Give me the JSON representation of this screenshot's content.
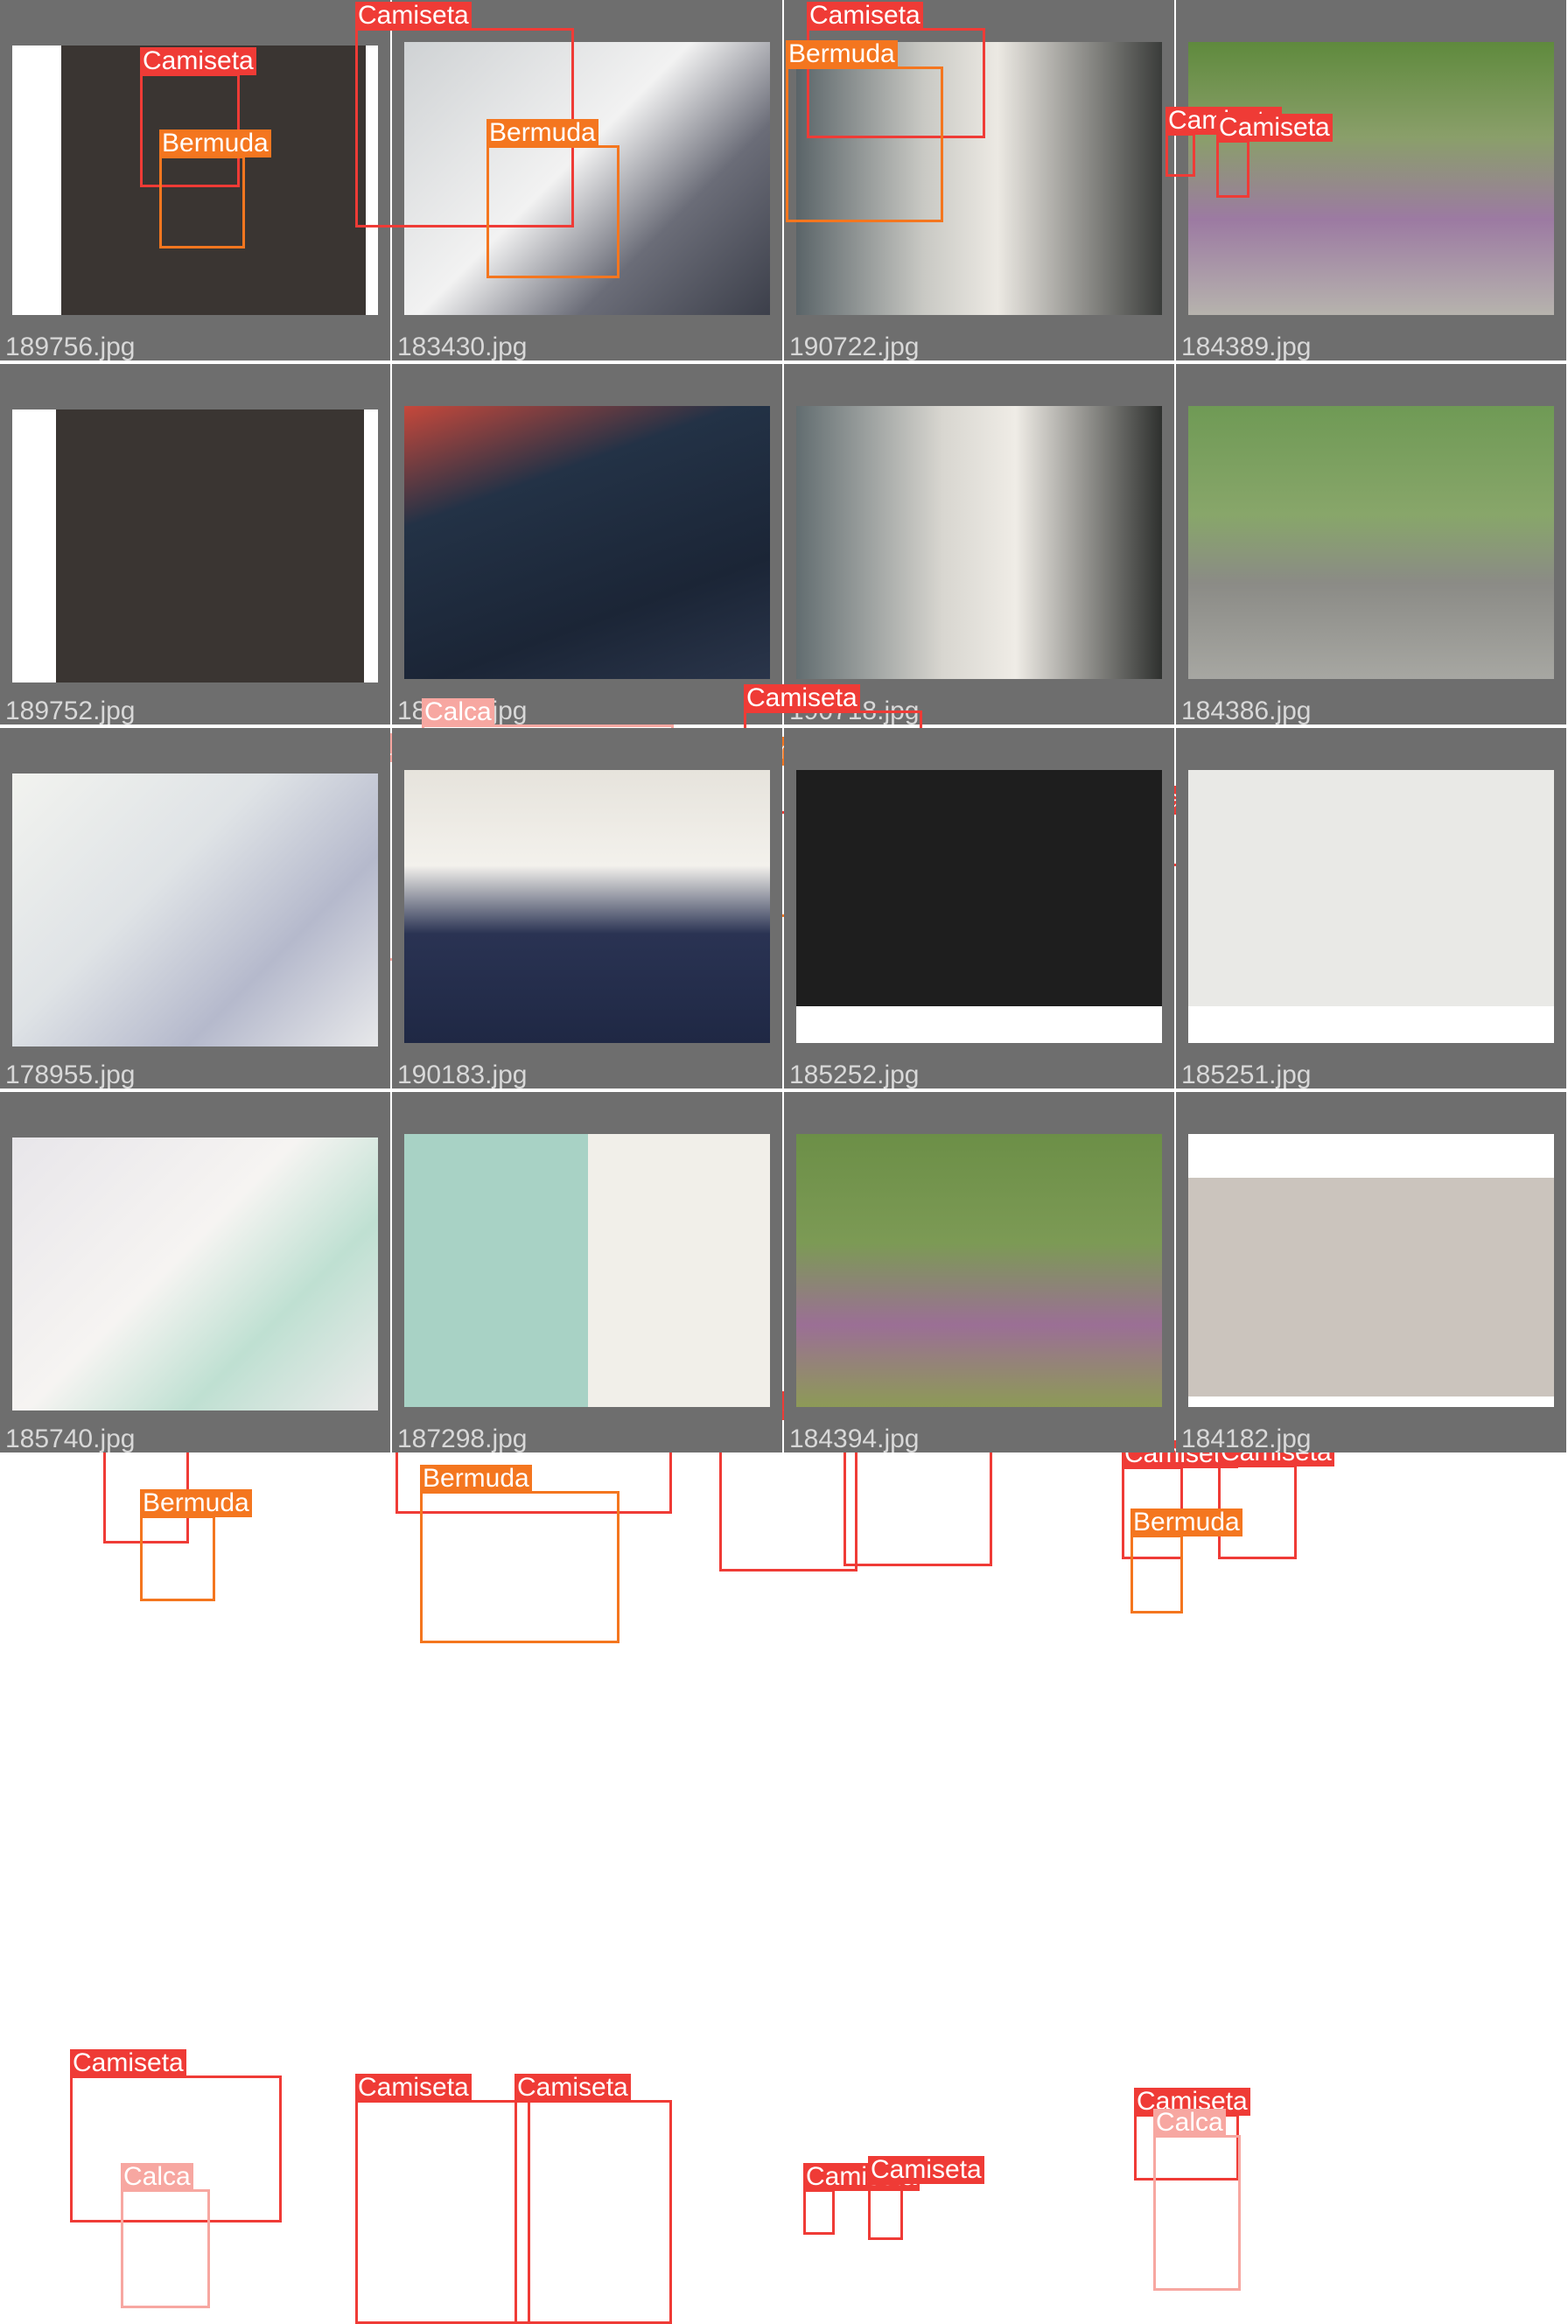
{
  "colors": {
    "Camiseta": "#ef3b36",
    "Bermuda": "#f4761f",
    "Calca": "#f7a7a1",
    "tile_bg": "#6e6e6e",
    "filename_text": "#d8d8d8"
  },
  "tiles": [
    {
      "filename": "189756.jpg",
      "labels": [
        {
          "class": "Camiseta"
        },
        {
          "class": "Bermuda"
        }
      ]
    },
    {
      "filename": "183430.jpg",
      "labels": [
        {
          "class": "Camiseta"
        },
        {
          "class": "Bermuda"
        }
      ]
    },
    {
      "filename": "190722.jpg",
      "labels": [
        {
          "class": "Camiseta"
        },
        {
          "class": "Bermuda"
        }
      ]
    },
    {
      "filename": "184389.jpg",
      "labels": [
        {
          "class": "Camiseta"
        },
        {
          "class": "Camiseta"
        }
      ]
    },
    {
      "filename": "189752.jpg",
      "labels": [
        {
          "class": "Camiseta"
        },
        {
          "class": "Bermuda"
        }
      ]
    },
    {
      "filename": "184829.jpg",
      "labels": [
        {
          "class": "Calca"
        },
        {
          "class": "Calca"
        }
      ]
    },
    {
      "filename": "190718.jpg",
      "labels": [
        {
          "class": "Camiseta"
        },
        {
          "class": "Bermuda"
        }
      ]
    },
    {
      "filename": "184386.jpg",
      "labels": [
        {
          "class": "Camiseta"
        },
        {
          "class": "Camiseta"
        }
      ]
    },
    {
      "filename": "178955.jpg",
      "labels": [
        {
          "class": "Camiseta"
        },
        {
          "class": "Bermuda"
        }
      ]
    },
    {
      "filename": "190183.jpg",
      "labels": [
        {
          "class": "Camiseta"
        },
        {
          "class": "Bermuda"
        }
      ]
    },
    {
      "filename": "185252.jpg",
      "labels": [
        {
          "class": "Camiseta"
        },
        {
          "class": "Camiseta"
        }
      ]
    },
    {
      "filename": "185251.jpg",
      "labels": [
        {
          "class": "Camiseta"
        },
        {
          "class": "Camiseta"
        },
        {
          "class": "Bermuda"
        }
      ]
    },
    {
      "filename": "185740.jpg",
      "labels": [
        {
          "class": "Camiseta"
        },
        {
          "class": "Calca"
        }
      ]
    },
    {
      "filename": "187298.jpg",
      "labels": [
        {
          "class": "Camiseta"
        },
        {
          "class": "Camiseta"
        }
      ]
    },
    {
      "filename": "184394.jpg",
      "labels": [
        {
          "class": "Camiseta"
        },
        {
          "class": "Camiseta"
        }
      ]
    },
    {
      "filename": "184182.jpg",
      "labels": [
        {
          "class": "Camiseta"
        },
        {
          "class": "Calca"
        }
      ]
    }
  ]
}
